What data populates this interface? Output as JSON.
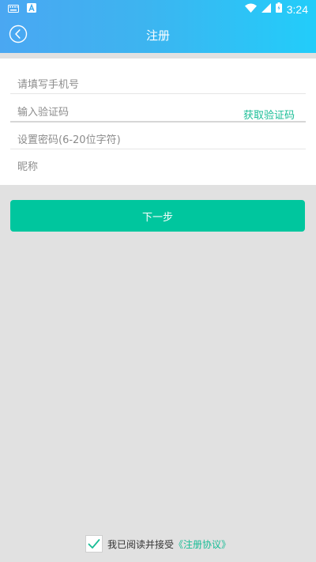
{
  "status_bar": {
    "time": "3:24",
    "left_icons": [
      "keyboard-icon",
      "app-notification-icon"
    ],
    "right_icons": [
      "wifi-icon",
      "cell-signal-icon",
      "battery-icon"
    ]
  },
  "header": {
    "title": "注册",
    "back_icon": "back-chevron-icon"
  },
  "form": {
    "phone_placeholder": "请填写手机号",
    "code_placeholder": "输入验证码",
    "get_code_label": "获取验证码",
    "password_placeholder": "设置密码(6-20位字符)",
    "nickname_placeholder": "昵称"
  },
  "next_button_label": "下一步",
  "agreement": {
    "checked": true,
    "text": "我已阅读并接受",
    "link_text": "《注册协议》"
  },
  "colors": {
    "header_gradient_start": "#4aa7f2",
    "header_gradient_end": "#22cdfa",
    "accent": "#00c69e",
    "link": "#19bd96",
    "background": "#e1e1e1"
  }
}
